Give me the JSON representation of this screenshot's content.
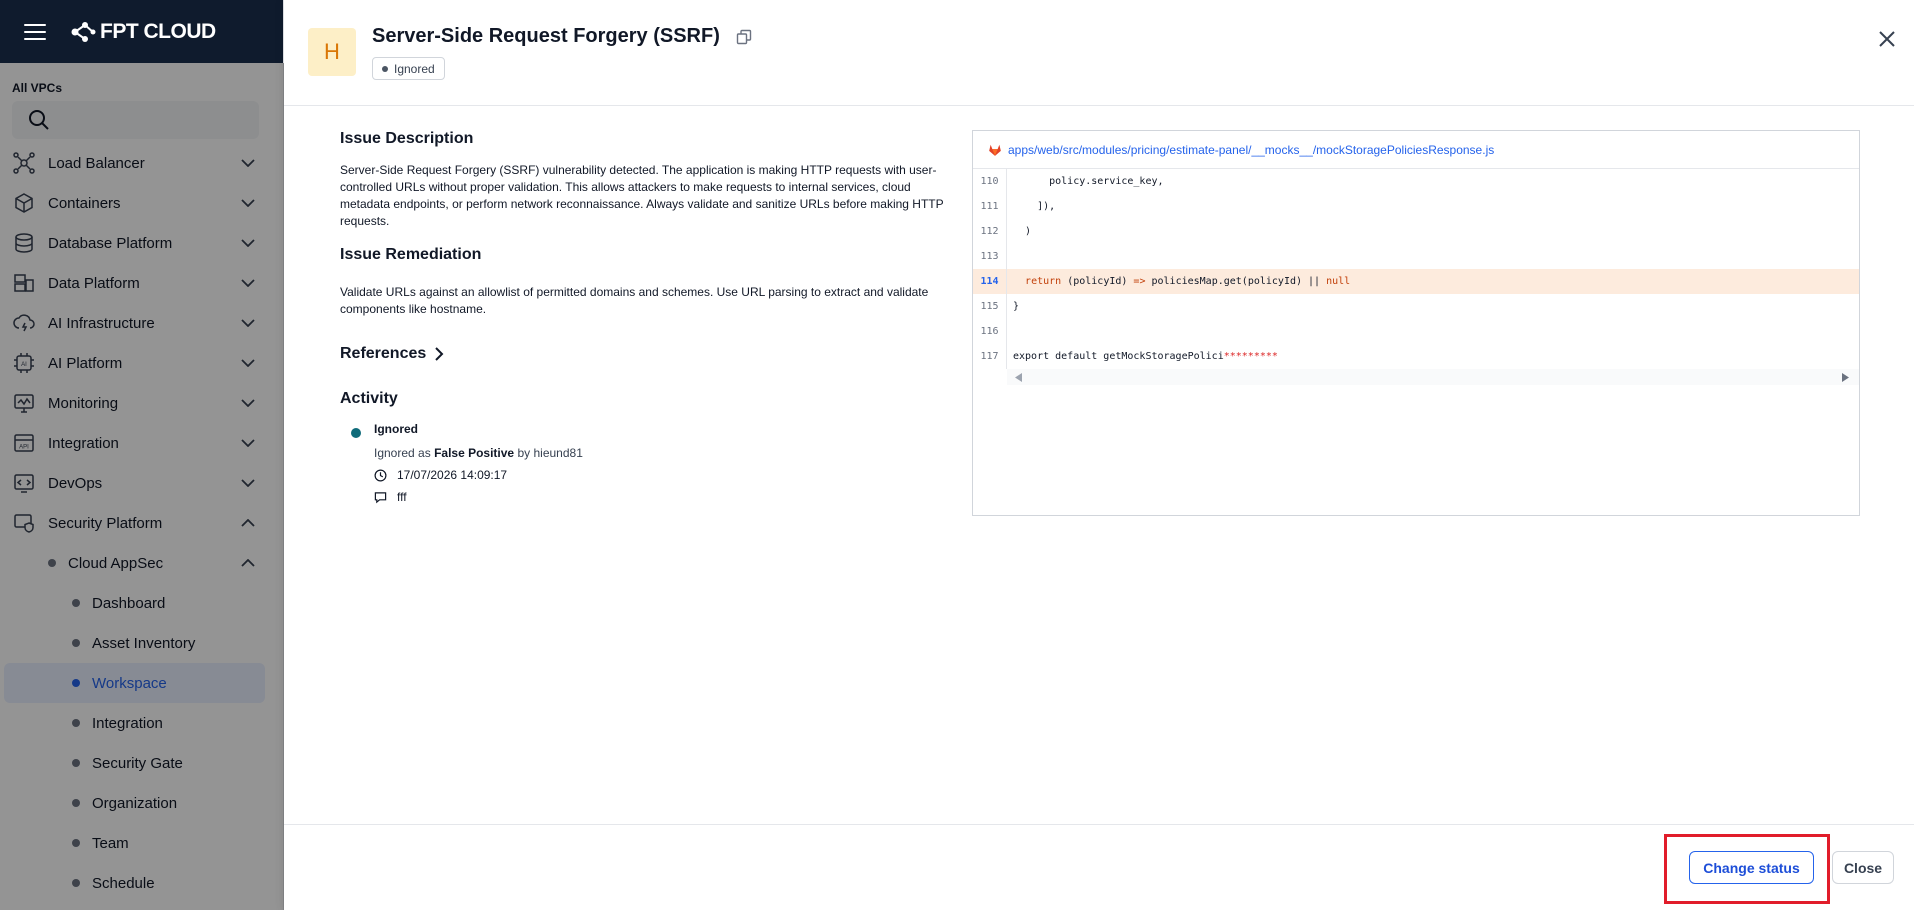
{
  "sidebar": {
    "brand": "FPT CLOUD",
    "vpc_label": "All VPCs",
    "nav": [
      {
        "label": "Load Balancer",
        "icon": "load-balancer-icon"
      },
      {
        "label": "Containers",
        "icon": "containers-icon"
      },
      {
        "label": "Database Platform",
        "icon": "database-icon"
      },
      {
        "label": "Data Platform",
        "icon": "data-platform-icon"
      },
      {
        "label": "AI Infrastructure",
        "icon": "ai-infrastructure-icon"
      },
      {
        "label": "AI Platform",
        "icon": "ai-platform-icon"
      },
      {
        "label": "Monitoring",
        "icon": "monitoring-icon"
      },
      {
        "label": "Integration",
        "icon": "api-icon"
      },
      {
        "label": "DevOps",
        "icon": "devops-icon"
      },
      {
        "label": "Security Platform",
        "icon": "security-icon"
      }
    ],
    "sub": {
      "label": "Cloud AppSec"
    },
    "sub_items": [
      "Dashboard",
      "Asset Inventory",
      "Workspace",
      "Integration",
      "Security Gate",
      "Organization",
      "Team",
      "Schedule"
    ],
    "active": "Workspace"
  },
  "drawer": {
    "severity": "H",
    "title": "Server-Side Request Forgery (SSRF)",
    "status": "Ignored",
    "description_heading": "Issue Description",
    "description": "Server-Side Request Forgery (SSRF) vulnerability detected. The application is making HTTP requests with user-controlled URLs without proper validation. This allows attackers to make requests to internal services, cloud metadata endpoints, or perform network reconnaissance. Always validate and sanitize URLs before making HTTP requests.",
    "remediation_heading": "Issue Remediation",
    "remediation": "Validate URLs against an allowlist of permitted domains and schemes. Use URL parsing to extract and validate components like hostname.",
    "references_label": "References",
    "activity_heading": "Activity",
    "activity": {
      "status": "Ignored",
      "prefix": "Ignored as",
      "reason": "False Positive",
      "by": "by",
      "user": "hieund81",
      "timestamp": "17/07/2026 14:09:17",
      "comment": "fff"
    },
    "code": {
      "file_path": "apps/web/src/modules/pricing/estimate-panel/__mocks__/mockStoragePoliciesResponse.js",
      "lines": [
        {
          "num": "110",
          "text": "      policy.service_key,"
        },
        {
          "num": "111",
          "text": "    ]),"
        },
        {
          "num": "112",
          "text": "  )"
        },
        {
          "num": "113",
          "text": ""
        },
        {
          "num": "114",
          "kw": "return",
          "mid": " (policyId) ",
          "arrow": "=>",
          "rest": " policiesMap.get(policyId) || ",
          "tail": "null"
        },
        {
          "num": "115",
          "text": "}"
        },
        {
          "num": "116",
          "text": ""
        },
        {
          "num": "117",
          "text": "export default getMockStoragePolici",
          "masked": "*********"
        }
      ]
    },
    "buttons": {
      "change_status": "Change status",
      "close": "Close"
    }
  }
}
